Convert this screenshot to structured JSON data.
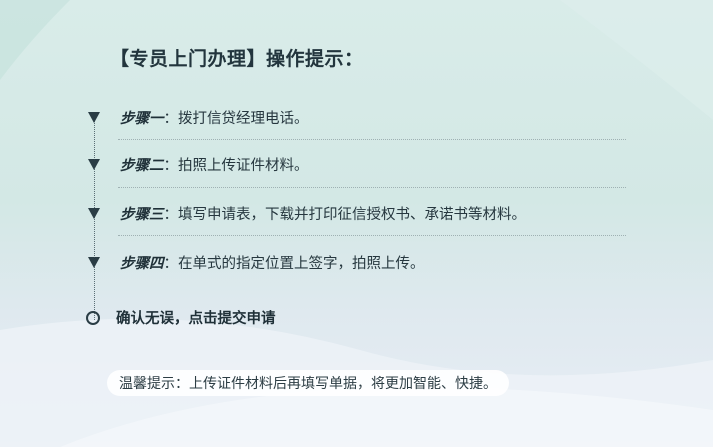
{
  "title": "【专员上门办理】操作提示：",
  "steps": [
    {
      "name": "步骤一",
      "sep": "：",
      "text": "拨打信贷经理电话。"
    },
    {
      "name": "步骤二",
      "sep": "：",
      "text": "拍照上传证件材料。"
    },
    {
      "name": "步骤三",
      "sep": "：",
      "text": "填写申请表，下载并打印征信授权书、承诺书等材料。"
    },
    {
      "name": "步骤四",
      "sep": "：",
      "text": "在单式的指定位置上签字，拍照上传。"
    }
  ],
  "confirm": "确认无误，点击提交申请",
  "tip": "温馨提示：上传证件材料后再填写单据，将更加智能、快捷。",
  "colors": {
    "bg_top": "#d9ece9",
    "bg_bottom": "#e8eef5",
    "text": "#233c46",
    "marker": "#2a3d45"
  },
  "icons": {
    "step_marker": "triangle-down-icon",
    "confirm_marker": "ring-icon"
  }
}
